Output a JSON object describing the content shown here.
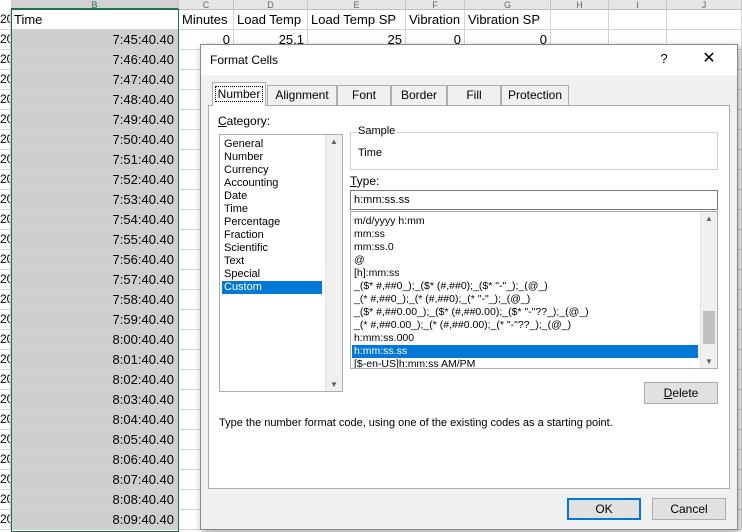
{
  "spreadsheet": {
    "row_stub_label": "20",
    "column_letters": [
      "B",
      "C",
      "D",
      "E",
      "F",
      "G",
      "H",
      "I",
      "J"
    ],
    "headers": [
      "Time",
      "Minutes",
      "Load Temp",
      "Load Temp SP",
      "Vibration",
      "Vibration SP"
    ],
    "first_data_row": [
      "7:45:40.40",
      "0",
      "25.1",
      "25",
      "0",
      "0"
    ],
    "time_values": [
      "7:45:40.40",
      "7:46:40.40",
      "7:47:40.40",
      "7:48:40.40",
      "7:49:40.40",
      "7:50:40.40",
      "7:51:40.40",
      "7:52:40.40",
      "7:53:40.40",
      "7:54:40.40",
      "7:55:40.40",
      "7:56:40.40",
      "7:57:40.40",
      "7:58:40.40",
      "7:59:40.40",
      "8:00:40.40",
      "8:01:40.40",
      "8:02:40.40",
      "8:03:40.40",
      "8:04:40.40",
      "8:05:40.40",
      "8:06:40.40",
      "8:07:40.40",
      "8:08:40.40",
      "8:09:40.40"
    ]
  },
  "dialog": {
    "title": "Format Cells",
    "help_glyph": "?",
    "close_glyph": "✕",
    "tabs": [
      {
        "label": "Number",
        "active": true
      },
      {
        "label": "Alignment",
        "active": false
      },
      {
        "label": "Font",
        "active": false
      },
      {
        "label": "Border",
        "active": false
      },
      {
        "label": "Fill",
        "active": false
      },
      {
        "label": "Protection",
        "active": false
      }
    ],
    "category_label": "Category:",
    "categories": [
      "General",
      "Number",
      "Currency",
      "Accounting",
      "Date",
      "Time",
      "Percentage",
      "Fraction",
      "Scientific",
      "Text",
      "Special",
      "Custom"
    ],
    "selected_category": "Custom",
    "sample_label": "Sample",
    "sample_value": "Time",
    "type_label": "Type:",
    "type_value": "h:mm:ss.ss",
    "type_list": [
      "m/d/yyyy h:mm",
      "mm:ss",
      "mm:ss.0",
      "@",
      "[h]:mm:ss",
      "_($* #,##0_);_($* (#,##0);_($* \"-\"_);_(@_)",
      "_(* #,##0_);_(* (#,##0);_(* \"-\"_);_(@_)",
      "_($* #,##0.00_);_($* (#,##0.00);_($* \"-\"??_);_(@_)",
      "_(* #,##0.00_);_(* (#,##0.00);_(* \"-\"??_);_(@_)",
      "h:mm:ss.000",
      "h:mm:ss.ss",
      "[$-en-US]h:mm:ss AM/PM"
    ],
    "selected_type": "h:mm:ss.ss",
    "delete_label": "Delete",
    "hint": "Type the number format code, using one of the existing codes as a starting point.",
    "ok_label": "OK",
    "cancel_label": "Cancel"
  },
  "colors": {
    "selection_blue": "#0078d7",
    "excel_green": "#217346",
    "selected_cells_gray": "#cfcfcf"
  }
}
